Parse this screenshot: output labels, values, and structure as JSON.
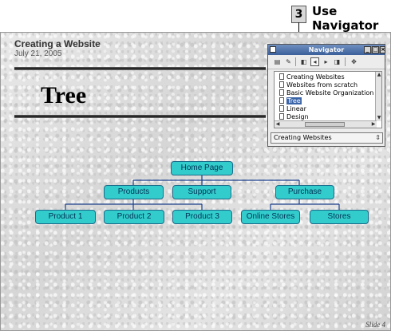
{
  "callout": {
    "number": "3",
    "line1": "Use",
    "line2": "Navigator"
  },
  "slide": {
    "title": "Creating a Website",
    "date": "July 21, 2005",
    "heading": "Tree",
    "number": "Slide 4"
  },
  "tree": {
    "root": "Home Page",
    "products": "Products",
    "support": "Support",
    "purchase": "Purchase",
    "product1": "Product 1",
    "product2": "Product 2",
    "product3": "Product 3",
    "online_stores": "Online Stores",
    "stores": "Stores",
    "node_color": "#33cccc",
    "line_color": "#1b3f8a"
  },
  "navigator": {
    "title": "Navigator",
    "items": [
      "Creating Websites",
      "Websites from scratch",
      "Basic Website Organization",
      "Tree",
      "Linear",
      "Design"
    ],
    "selected_item": "Tree",
    "document_select": "Creating Websites"
  }
}
